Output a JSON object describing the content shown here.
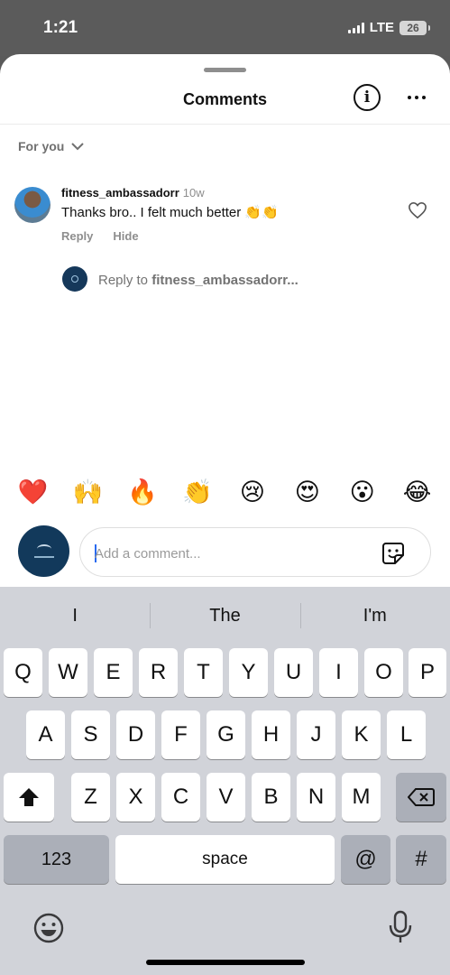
{
  "status": {
    "time": "1:21",
    "network": "LTE",
    "battery": "26"
  },
  "header": {
    "title": "Comments",
    "info_icon": "info-icon",
    "more_icon": "more-horizontal-icon"
  },
  "filter": {
    "label": "For you",
    "icon": "chevron-down-icon"
  },
  "comment": {
    "username": "fitness_ambassadorr",
    "ago": "10w",
    "text": "Thanks bro.. I felt much better 👏👏",
    "reply_label": "Reply",
    "hide_label": "Hide",
    "like_icon": "heart-outline-icon"
  },
  "reply": {
    "prefix": "Reply to ",
    "target": "fitness_ambassadorr..."
  },
  "reactions": [
    "❤️",
    "🙌",
    "🔥",
    "👏",
    "😢",
    "😍",
    "😮",
    "😂"
  ],
  "composer": {
    "placeholder": "Add a comment...",
    "sticker_icon": "sticker-icon"
  },
  "keyboard": {
    "suggestions": [
      "I",
      "The",
      "I'm"
    ],
    "row1": [
      "Q",
      "W",
      "E",
      "R",
      "T",
      "Y",
      "U",
      "I",
      "O",
      "P"
    ],
    "row2": [
      "A",
      "S",
      "D",
      "F",
      "G",
      "H",
      "J",
      "K",
      "L"
    ],
    "row3": [
      "Z",
      "X",
      "C",
      "V",
      "B",
      "N",
      "M"
    ],
    "numbers": "123",
    "space": "space",
    "at": "@",
    "hash": "#",
    "shift_icon": "shift-icon",
    "delete_icon": "backspace-icon",
    "emoji_icon": "emoji-keyboard-icon",
    "mic_icon": "microphone-icon"
  },
  "colors": {
    "accent": "#2a6bf0",
    "keyboard_bg": "#d1d3d9",
    "avatar_navy": "#12395b"
  }
}
